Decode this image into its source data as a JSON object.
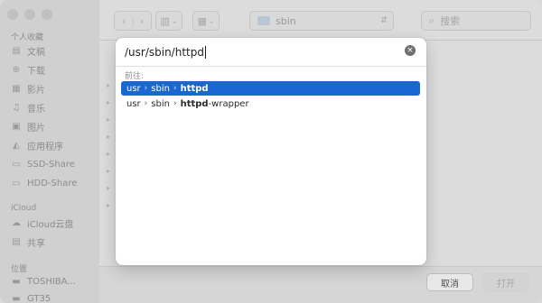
{
  "sidebar": {
    "sections": {
      "favorites": "个人收藏",
      "icloud": "iCloud",
      "locations": "位置"
    },
    "favorites_items": [
      {
        "label": "文稿",
        "icon": "document-icon"
      },
      {
        "label": "下载",
        "icon": "download-icon"
      },
      {
        "label": "影片",
        "icon": "movies-icon"
      },
      {
        "label": "音乐",
        "icon": "music-icon"
      },
      {
        "label": "图片",
        "icon": "pictures-icon"
      },
      {
        "label": "应用程序",
        "icon": "applications-icon"
      },
      {
        "label": "SSD-Share",
        "icon": "folder-icon"
      },
      {
        "label": "HDD-Share",
        "icon": "folder-icon"
      }
    ],
    "icloud_items": [
      {
        "label": "iCloud云盘",
        "icon": "cloud-icon"
      },
      {
        "label": "共享",
        "icon": "shared-icon"
      }
    ],
    "locations_items": [
      {
        "label": "TOSHIBA...",
        "icon": "drive-icon"
      },
      {
        "label": "GT35",
        "icon": "drive-icon"
      }
    ]
  },
  "toolbar": {
    "path": "sbin",
    "search_placeholder": "搜索"
  },
  "goto": {
    "input_value": "/usr/sbin/httpd",
    "section_label": "前往:",
    "suggestions": [
      {
        "parts": [
          "usr",
          "sbin"
        ],
        "name_bold": "httpd",
        "name_rest": ""
      },
      {
        "parts": [
          "usr",
          "sbin"
        ],
        "name_bold": "httpd",
        "name_rest": "-wrapper"
      }
    ]
  },
  "footer": {
    "cancel_label": "取消",
    "open_label": "打开"
  }
}
